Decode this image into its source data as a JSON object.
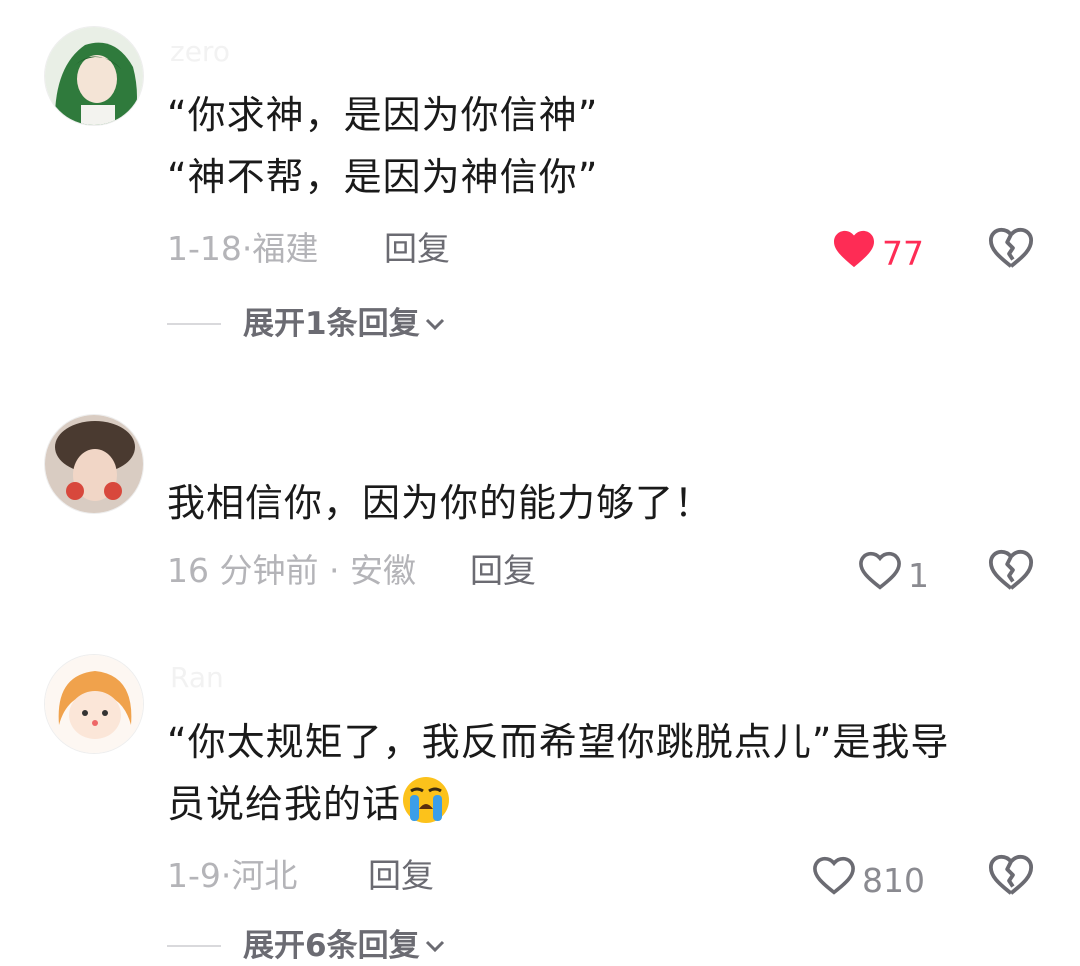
{
  "comments": [
    {
      "username": "zero",
      "text_lines": [
        "“你求神，是因为你信神”",
        "“神不帮，是因为神信你”"
      ],
      "date": "1-18",
      "location": "福建",
      "reply_label": "回复",
      "likes": "77",
      "liked": true,
      "expand_label": "展开1条回复"
    },
    {
      "username": "",
      "text_lines": [
        "我相信你，因为你的能力够了！"
      ],
      "date": "16 分钟前",
      "location": "安徽",
      "reply_label": "回复",
      "likes": "1",
      "liked": false
    },
    {
      "username": "Ran",
      "text_lines": [
        "“你太规矩了，我反而希望你跳脱点儿”是我导",
        "员说给我的话"
      ],
      "emoji": "loudly-crying-face-icon",
      "date": "1-9",
      "location": "河北",
      "reply_label": "回复",
      "likes": "810",
      "liked": false,
      "expand_label": "展开6条回复"
    }
  ],
  "meta_separator": "·",
  "colors": {
    "liked": "#fe2c55",
    "meta": "#b4b4b8",
    "text": "#1a1a1a"
  }
}
